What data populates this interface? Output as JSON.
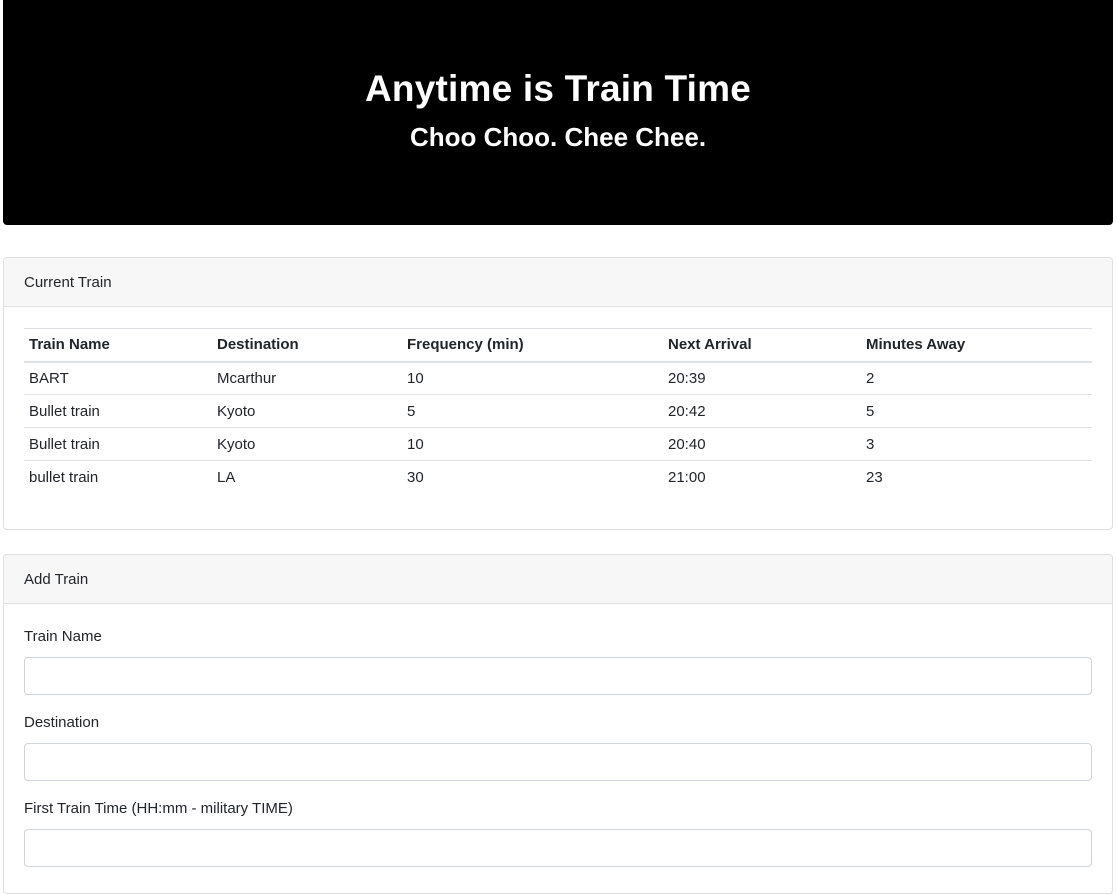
{
  "header": {
    "title": "Anytime is Train Time",
    "subtitle": "Choo Choo. Chee Chee."
  },
  "current_train": {
    "title": "Current Train",
    "columns": [
      "Train Name",
      "Destination",
      "Frequency (min)",
      "Next Arrival",
      "Minutes Away"
    ],
    "rows": [
      [
        "BART",
        "Mcarthur",
        "10",
        "20:39",
        "2"
      ],
      [
        "Bullet train",
        "Kyoto",
        "5",
        "20:42",
        "5"
      ],
      [
        "Bullet train",
        "Kyoto",
        "10",
        "20:40",
        "3"
      ],
      [
        "bullet train",
        "LA",
        "30",
        "21:00",
        "23"
      ]
    ]
  },
  "add_train": {
    "title": "Add Train",
    "fields": [
      {
        "label": "Train Name",
        "value": "",
        "placeholder": ""
      },
      {
        "label": "Destination",
        "value": "",
        "placeholder": ""
      },
      {
        "label": "First Train Time (HH:mm - military TIME)",
        "value": "",
        "placeholder": ""
      }
    ]
  },
  "colors": {
    "header_bg": "#000000",
    "header_text": "#ffffff",
    "card_header_bg": "#f7f7f7",
    "border": "#dfdfdf"
  }
}
